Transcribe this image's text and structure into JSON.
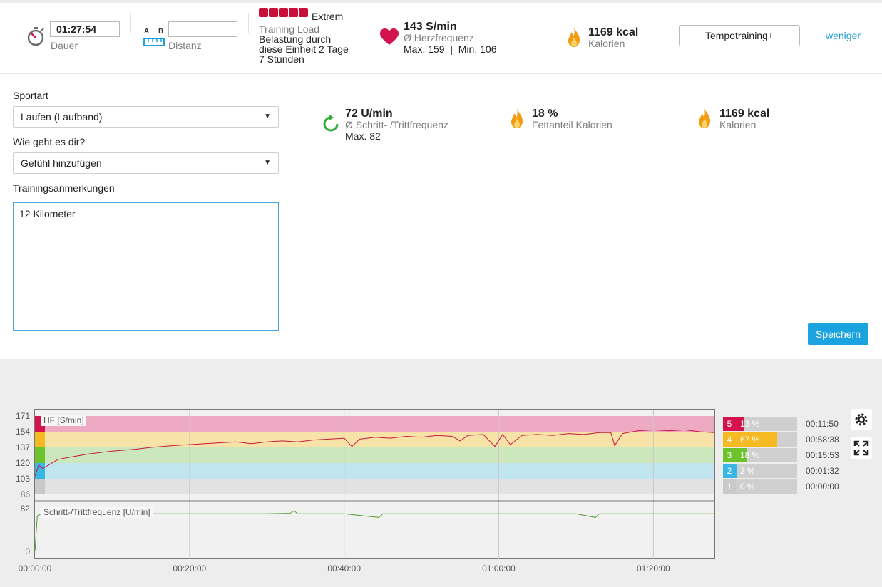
{
  "summary": {
    "duration_value": "01:27:54",
    "duration_label": "Dauer",
    "distance_a": "A",
    "distance_b": "B",
    "distance_value": "",
    "distance_label": "Distanz",
    "load_level": "Extrem",
    "training_load_label": "Training Load",
    "load_text_1": "Belastung durch",
    "load_text_2": "diese Einheit 2 Tage",
    "load_text_3": "7 Stunden",
    "hr_value": "143 S/min",
    "hr_label": "Ø Herzfrequenz",
    "hr_minmax": "Max. 159  |  Min. 106",
    "calories_value": "1169 kcal",
    "calories_label": "Kalorien",
    "sport_profile_button": "Tempotraining+",
    "less_link": "weniger"
  },
  "form": {
    "sport_label": "Sportart",
    "sport_value": "Laufen (Laufband)",
    "feeling_label": "Wie geht es dir?",
    "feeling_value": "Gefühl hinzufügen",
    "notes_label": "Trainingsanmerkungen",
    "notes_value": "12 Kilometer",
    "save_button": "Speichern"
  },
  "stats": {
    "cadence_value": "72 U/min",
    "cadence_label": "Ø Schritt- /Trittfrequenz",
    "cadence_max": "Max. 82",
    "fat_value": "18 %",
    "fat_label": "Fettanteil Kalorien",
    "calories_value": "1169 kcal",
    "calories_label": "Kalorien"
  },
  "colors": {
    "accent": "#1aa3df",
    "zone5": "#d4124e",
    "zone4": "#f5b921",
    "zone3": "#6cc32b",
    "zone2": "#38b7e5",
    "zone1": "#c9c9c9",
    "flame": "#f39c12",
    "heart": "#d4124e",
    "hr_line": "#c8163c",
    "cadence_line": "#4d9b2c"
  },
  "chart_data": [
    {
      "type": "line",
      "series_label": "HF [S/min]",
      "y_ticks": [
        "171",
        "154",
        "137",
        "120",
        "103",
        "86"
      ],
      "ylim": [
        86,
        171
      ],
      "x_ticks": [
        "00:00:00",
        "00:20:00",
        "00:40:00",
        "01:00:00",
        "01:20:00"
      ],
      "xlim_minutes": [
        0,
        87.9
      ],
      "zones": [
        {
          "zone": "5",
          "from": 154,
          "to": 171
        },
        {
          "zone": "4",
          "from": 137,
          "to": 154
        },
        {
          "zone": "3",
          "from": 120,
          "to": 137
        },
        {
          "zone": "2",
          "from": 103,
          "to": 120
        },
        {
          "zone": "1",
          "from": 86,
          "to": 103
        }
      ],
      "points_minutes": [
        [
          0,
          106
        ],
        [
          0.5,
          118
        ],
        [
          1,
          114
        ],
        [
          2,
          119
        ],
        [
          3,
          124
        ],
        [
          5,
          127
        ],
        [
          7,
          130
        ],
        [
          10,
          133
        ],
        [
          13,
          135
        ],
        [
          15,
          137
        ],
        [
          18,
          139
        ],
        [
          20,
          140
        ],
        [
          22,
          141
        ],
        [
          24,
          142
        ],
        [
          26,
          143
        ],
        [
          28,
          141
        ],
        [
          30,
          143
        ],
        [
          32,
          144
        ],
        [
          34,
          143
        ],
        [
          36,
          145
        ],
        [
          38,
          146
        ],
        [
          40,
          147
        ],
        [
          41,
          138
        ],
        [
          42,
          146
        ],
        [
          44,
          148
        ],
        [
          46,
          147
        ],
        [
          48,
          149
        ],
        [
          50,
          148
        ],
        [
          52,
          150
        ],
        [
          54,
          149
        ],
        [
          55,
          144
        ],
        [
          56,
          150
        ],
        [
          58,
          151
        ],
        [
          59.5,
          138
        ],
        [
          60.5,
          151
        ],
        [
          61.5,
          140
        ],
        [
          63,
          150
        ],
        [
          65,
          151
        ],
        [
          67,
          150
        ],
        [
          69,
          152
        ],
        [
          71,
          151
        ],
        [
          73,
          153
        ],
        [
          74.5,
          153
        ],
        [
          75,
          139
        ],
        [
          76,
          152
        ],
        [
          78,
          155
        ],
        [
          80,
          156
        ],
        [
          82,
          155
        ],
        [
          84,
          156
        ],
        [
          86,
          154
        ],
        [
          87.9,
          153
        ]
      ]
    },
    {
      "type": "line",
      "series_label": "Schritt-/Trittfrequenz [U/min]",
      "y_ticks": [
        "82",
        "0"
      ],
      "ylim": [
        0,
        82
      ],
      "points_minutes": [
        [
          0,
          0
        ],
        [
          0.3,
          68
        ],
        [
          0.8,
          72
        ],
        [
          2,
          72
        ],
        [
          10,
          72
        ],
        [
          20,
          72
        ],
        [
          30,
          72
        ],
        [
          33,
          73
        ],
        [
          33.5,
          78
        ],
        [
          34,
          72
        ],
        [
          40,
          72
        ],
        [
          44.5,
          65
        ],
        [
          45,
          72
        ],
        [
          50,
          72
        ],
        [
          60,
          72
        ],
        [
          70,
          72
        ],
        [
          72.5,
          65
        ],
        [
          73,
          72
        ],
        [
          80,
          72
        ],
        [
          87.9,
          72
        ]
      ]
    }
  ],
  "zones_table": [
    {
      "zone": "5",
      "pct": "13 %",
      "fraction": 0.13,
      "time": "00:11:50"
    },
    {
      "zone": "4",
      "pct": "67 %",
      "fraction": 0.67,
      "time": "00:58:38"
    },
    {
      "zone": "3",
      "pct": "18 %",
      "fraction": 0.18,
      "time": "00:15:53"
    },
    {
      "zone": "2",
      "pct": "2 %",
      "fraction": 0.02,
      "time": "00:01:32"
    },
    {
      "zone": "1",
      "pct": "0 %",
      "fraction": 0.0,
      "time": "00:00:00"
    }
  ],
  "icons": {
    "stopwatch": "stopwatch-icon",
    "ruler": "ruler-icon",
    "heart": "heart-icon",
    "flame": "flame-icon",
    "cadence": "cadence-icon",
    "settings": "gear-icon",
    "fullscreen": "fullscreen-icon"
  }
}
